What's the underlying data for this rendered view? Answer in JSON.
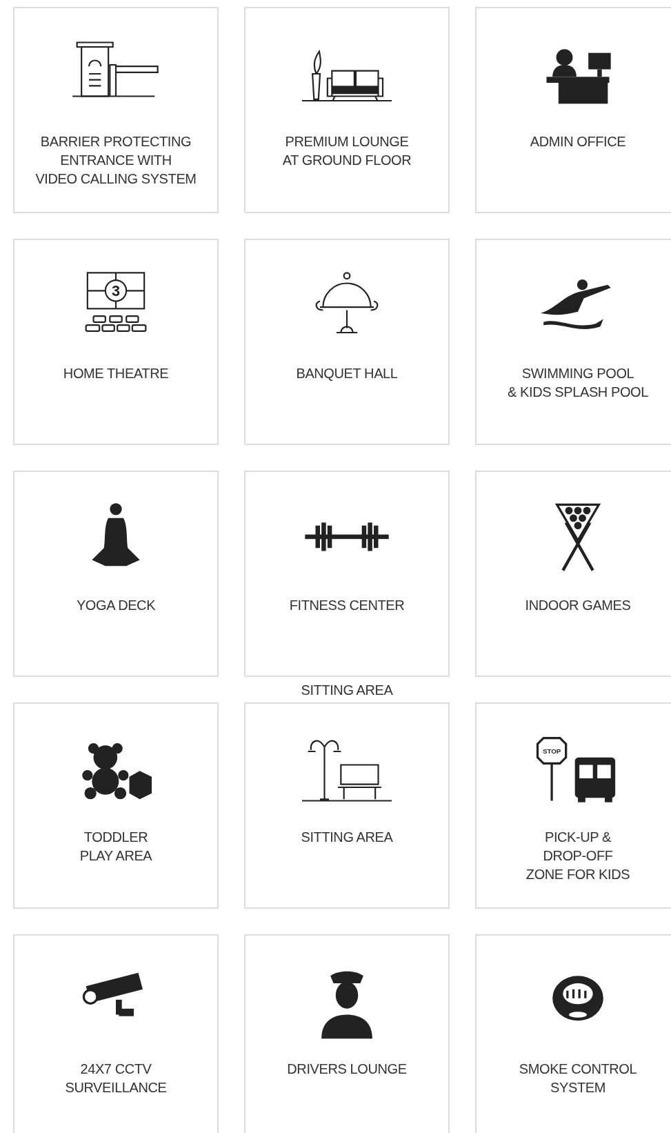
{
  "rows": [
    {
      "cards": [
        {
          "kind": "barrier",
          "label": "BARRIER PROTECTING\nENTRANCE WITH\nVIDEO CALLING SYSTEM"
        },
        {
          "kind": "sofa",
          "label": "PREMIUM LOUNGE\nAT GROUND FLOOR"
        },
        {
          "kind": "desk",
          "label": "ADMIN OFFICE"
        }
      ]
    },
    {
      "cards": [
        {
          "kind": "theatre",
          "icon_text": "3",
          "label": "HOME THEATRE"
        },
        {
          "kind": "cloche",
          "label": "BANQUET HALL"
        },
        {
          "kind": "swimmer",
          "label": "SWIMMING POOL\n& KIDS SPLASH POOL"
        }
      ]
    },
    {
      "cards": [
        {
          "kind": "yoga",
          "label": "YOGA DECK"
        },
        {
          "kind": "dumbbell",
          "label": "FITNESS CENTER"
        },
        {
          "kind": "billiards",
          "label": "INDOOR GAMES"
        }
      ]
    },
    {
      "cards": [
        {
          "kind": "teddy",
          "label": "TODDLER\nPLAY AREA"
        },
        {
          "kind": "bench",
          "caption_above": "SITTING AREA",
          "label": "SITTING AREA"
        },
        {
          "kind": "bus",
          "icon_text": "STOP",
          "label": "PICK-UP &\nDROP-OFF\nZONE FOR KIDS"
        }
      ]
    },
    {
      "cards": [
        {
          "kind": "camera",
          "label": "24X7 CCTV\nSURVEILLANCE"
        },
        {
          "kind": "driver",
          "label": "DRIVERS LOUNGE"
        },
        {
          "kind": "smoke",
          "label": "SMOKE CONTROL\nSYSTEM"
        }
      ]
    }
  ]
}
